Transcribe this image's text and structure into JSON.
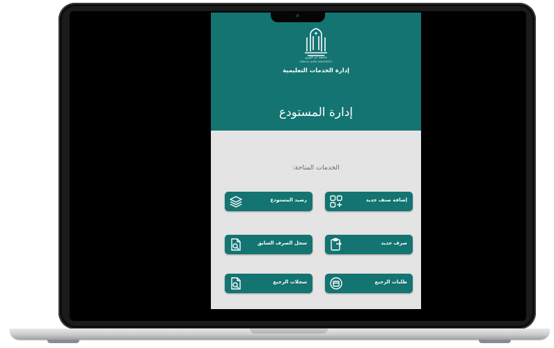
{
  "app": {
    "university_name": "جامعة أم القرى",
    "university_name_en": "UMM AL-QURA UNIVERSITY",
    "department": "إدارة الخدمات التعليمية",
    "title": "إدارة المستودع",
    "services_label": "الخدمات المتاحة:"
  },
  "buttons": [
    {
      "label": "إضافة صنف جديد",
      "icon": "grid-plus-icon"
    },
    {
      "label": "رصيد المستودع",
      "icon": "layers-icon"
    },
    {
      "label": "صرف جديد",
      "icon": "clipboard-icon"
    },
    {
      "label": "سجل الصرف السابق",
      "icon": "document-search-icon"
    },
    {
      "label": "طلبات الرجيع",
      "icon": "return-box-icon"
    },
    {
      "label": "سجلات الرجيع",
      "icon": "document-search-icon"
    }
  ],
  "colors": {
    "primary": "#137471",
    "background": "#e4e4e4"
  }
}
